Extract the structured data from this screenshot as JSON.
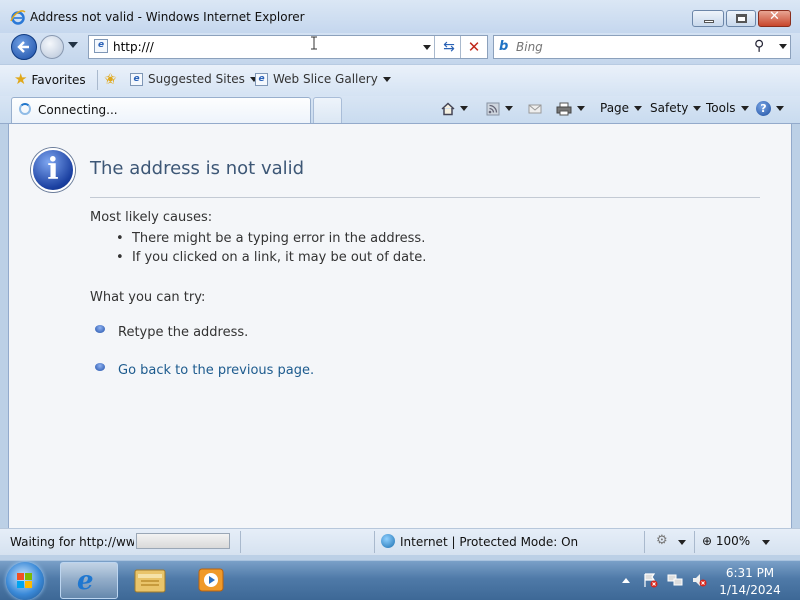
{
  "window": {
    "title": "Address not valid - Windows Internet Explorer"
  },
  "navigation": {
    "address_value": "http:///",
    "search_placeholder": "Bing"
  },
  "favorites_bar": {
    "favorites_label": "Favorites",
    "suggested_sites_label": "Suggested Sites",
    "web_slice_gallery_label": "Web Slice Gallery"
  },
  "tab": {
    "label": "Connecting..."
  },
  "command_bar": {
    "page_label": "Page",
    "safety_label": "Safety",
    "tools_label": "Tools",
    "help_symbol": "?"
  },
  "content": {
    "title": "The address is not valid",
    "causes_heading": "Most likely causes:",
    "causes": [
      "There might be a typing error in the address.",
      "If you clicked on a link, it may be out of date."
    ],
    "try_heading": "What you can try:",
    "suggestions": [
      "Retype the address.",
      "Go back to the previous page."
    ]
  },
  "status_bar": {
    "status_text": "Waiting for http://www...",
    "zone_text": "Internet | Protected Mode: On",
    "zoom_level": "100%"
  },
  "taskbar": {
    "time": "6:31 PM",
    "date": "1/14/2024"
  },
  "colors": {
    "link": "#1d5b8e",
    "heading": "#3d5776",
    "accent": "#1f4fa8"
  }
}
